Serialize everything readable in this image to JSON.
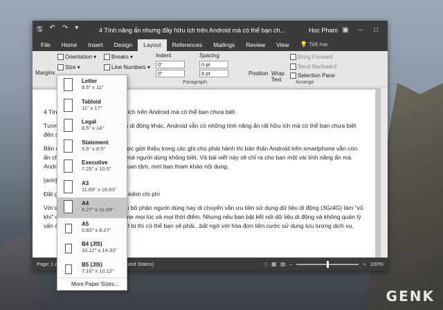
{
  "window": {
    "title": "4 Tính năng ẩn nhưng đầy hữu ích trên Android mà có thể bạn ch...",
    "user": "Hoc Pham",
    "tabs": [
      "File",
      "Home",
      "Insert",
      "Design",
      "Layout",
      "References",
      "Mailings",
      "Review",
      "View"
    ],
    "active_tab": "Layout",
    "tell_me": "Tell me"
  },
  "ribbon": {
    "margins": "Margins",
    "orientation": "Orientation",
    "size": "Size",
    "breaks": "Breaks",
    "line_numbers": "Line Numbers",
    "indent_label": "Indent",
    "spacing_label": "Spacing",
    "indent_left": "0\"",
    "indent_right": "0\"",
    "spacing_before": "0 pt",
    "spacing_after": "8 pt",
    "paragraph_group": "Paragraph",
    "position": "Position",
    "wrap_text": "Wrap Text",
    "bring_forward": "Bring Forward",
    "send_backward": "Send Backward",
    "selection_pane": "Selection Pane",
    "arrange_group": "Arrange"
  },
  "document": {
    "lines": [
      "4 Tính năng ẩn nhưng đầy hữu ích trên Android mà có thể bạn chưa biết",
      "Tương tự như các hệ điều hành di động khác, Android vẫn có những tính năng ẩn rất hữu ích mà có thể bạn chưa biết đến sự tồn tại của nó.",
      "Bên cạnh các tính năng mới được giới thiệu trong các ghi chú phát hành thì bản thân Android trên smartphone vẫn còn ẩn chứa rất nhiều tính năng ẩn mà người dùng không biết. Và bài viết này sẽ chỉ ra cho bạn một vài tính năng ẩn mà Android đang... ẩn chứa. Nếu quan tâm, mời bạn tham khảo nội dung.",
      "[anh]",
      "Đặt giới hạn dữ liệu di động tiết kiệm chi phí",
      "Với sự phổ biến hiện nay, thì đại bộ phận người dùng hay di chuyển vẫn ưu tiên sử dụng dữ liệu di động (3G/4G) làm “vũ khí” chính để giữ trạng thái Online mọi lúc và mọi thời điểm. Nhưng nếu bạn bật kết nối dữ liệu di động và không quản lý vấn đề sử dụng dữ liệu trên thiết bị thì có thể bạn sẽ phải...bất ngờ với hóa đơn tiền cước sử dụng lưu lượng dịch vụ."
    ]
  },
  "status": {
    "page": "Page 1 of",
    "language": "nited States)",
    "zoom": "100%"
  },
  "size_menu": {
    "items": [
      {
        "name": "Letter",
        "dims": "8.5\" x 11\""
      },
      {
        "name": "Tabloid",
        "dims": "11\" x 17\""
      },
      {
        "name": "Legal",
        "dims": "8.5\" x 14\""
      },
      {
        "name": "Statement",
        "dims": "5.5\" x 8.5\""
      },
      {
        "name": "Executive",
        "dims": "7.25\" x 10.5\""
      },
      {
        "name": "A3",
        "dims": "11.69\" x 16.53\""
      },
      {
        "name": "A4",
        "dims": "8.27\" x 11.69\""
      },
      {
        "name": "A5",
        "dims": "5.83\" x 8.27\""
      },
      {
        "name": "B4 (JIS)",
        "dims": "10.12\" x 14.33\""
      },
      {
        "name": "B5 (JIS)",
        "dims": "7.16\" x 10.12\""
      }
    ],
    "selected": "A4",
    "more": "More Paper Sizes..."
  },
  "watermark": "GENK"
}
